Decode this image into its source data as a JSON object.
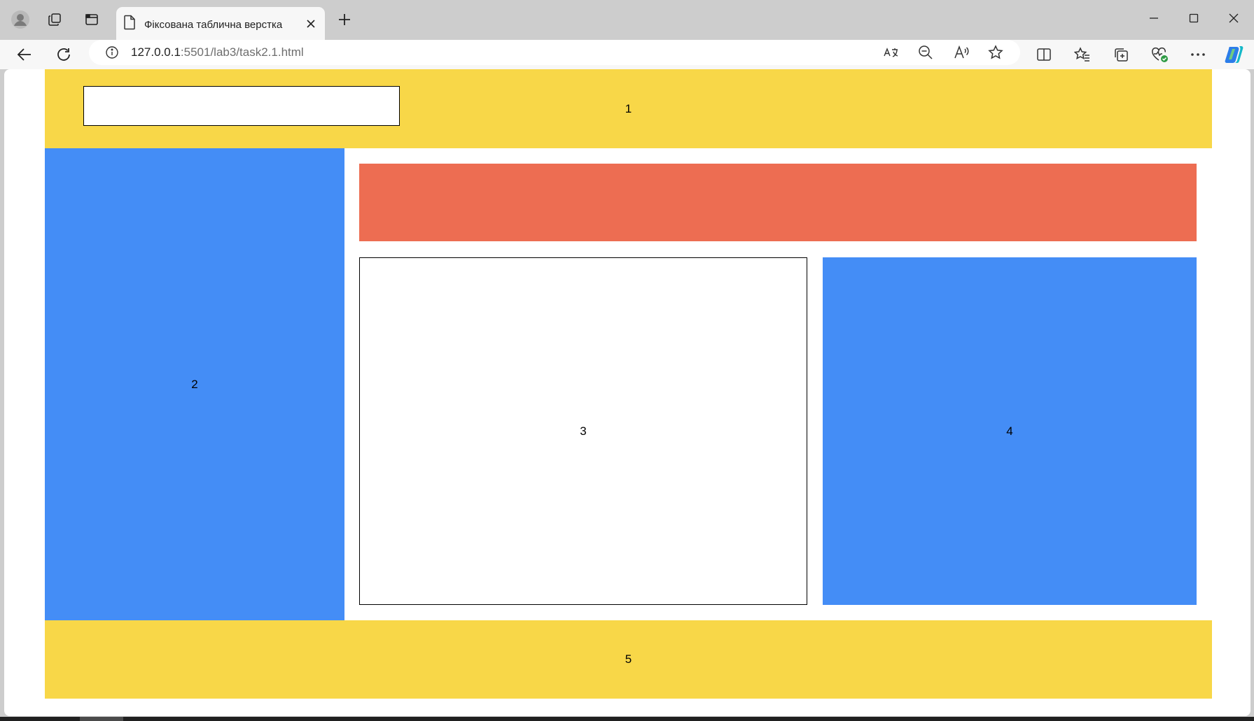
{
  "browser": {
    "tab_title": "Фіксована таблична верстка",
    "url_host": "127.0.0.1",
    "url_rest": ":5501/lab3/task2.1.html"
  },
  "icons": {
    "titlebar": [
      "profile-icon",
      "workspaces-icon",
      "vertical-tabs-icon",
      "file-icon",
      "close-icon",
      "new-tab-icon",
      "minimize-icon",
      "maximize-icon",
      "close-window-icon"
    ],
    "toolbar": [
      "back-icon",
      "refresh-icon",
      "site-info-icon",
      "translate-icon",
      "zoom-out-icon",
      "read-aloud-icon",
      "favorite-star-icon",
      "split-screen-icon",
      "favorites-icon",
      "collections-icon",
      "browser-essentials-icon",
      "more-icon",
      "copilot-icon"
    ]
  },
  "page": {
    "header_label": "1",
    "sidebar_label": "2",
    "content_label": "3",
    "aside_label": "4",
    "footer_label": "5"
  },
  "colors": {
    "yellow": "#f8d748",
    "blue": "#448df6",
    "red": "#ed6d52"
  }
}
